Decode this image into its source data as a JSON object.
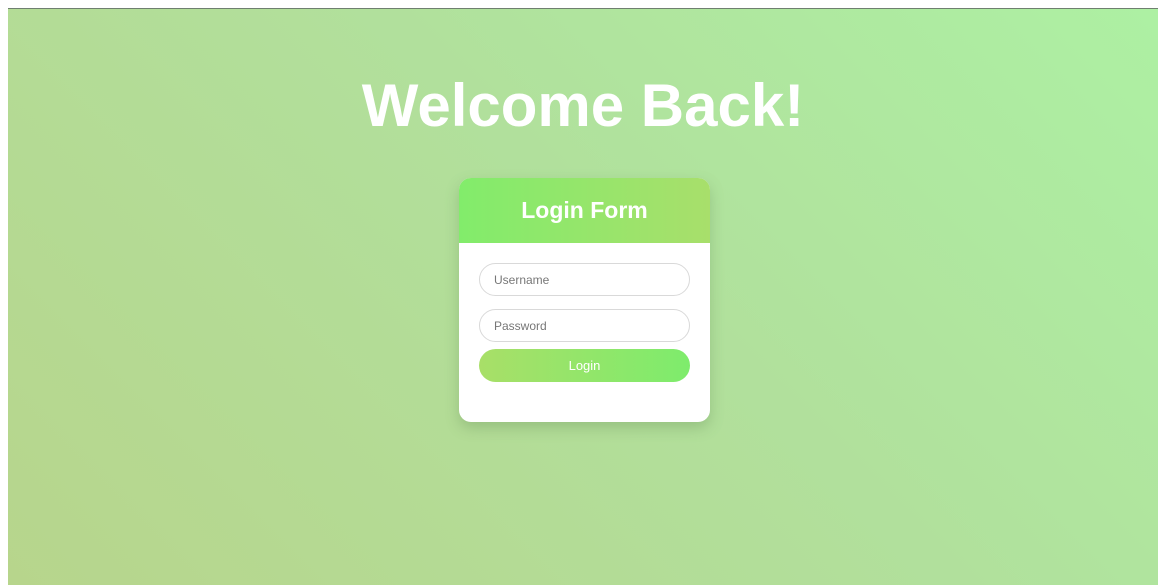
{
  "page": {
    "heading": "Welcome Back!"
  },
  "login_form": {
    "title": "Login Form",
    "username_placeholder": "Username",
    "password_placeholder": "Password",
    "submit_label": "Login"
  },
  "colors": {
    "background_gradient": [
      "#adf0a3",
      "#b7d58c"
    ],
    "header_gradient": [
      "#82ec6b",
      "#a8df6b"
    ],
    "button_gradient": [
      "#a8df68",
      "#7eec6c"
    ],
    "text_on_color": "#ffffff"
  }
}
